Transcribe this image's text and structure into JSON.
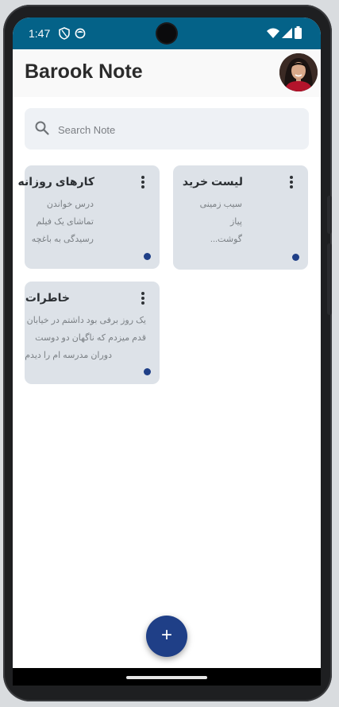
{
  "status_bar": {
    "time": "1:47"
  },
  "app_bar": {
    "title": "Barook Note"
  },
  "search": {
    "placeholder": "Search Note",
    "value": ""
  },
  "notes": [
    {
      "title": "کارهای روزانه",
      "lines": [
        "درس خواندن",
        "تماشای یک فیلم",
        "رسیدگی به باغچه"
      ]
    },
    {
      "title": "لیست خرید",
      "lines": [
        "سیب زمینی",
        "پیاز",
        "گوشت..."
      ]
    },
    {
      "title": "خاطرات",
      "lines": [
        "یک روز برفی بود داشتم در خیابان",
        "قدم میزدم که ناگهان دو دوست",
        "دوران مدرسه ام را دیدم"
      ]
    }
  ],
  "fab": {
    "label": "+"
  },
  "colors": {
    "status_bar": "#046288",
    "card": "#dde2e8",
    "accent": "#1f3f87",
    "search_bg": "#eef1f5"
  }
}
